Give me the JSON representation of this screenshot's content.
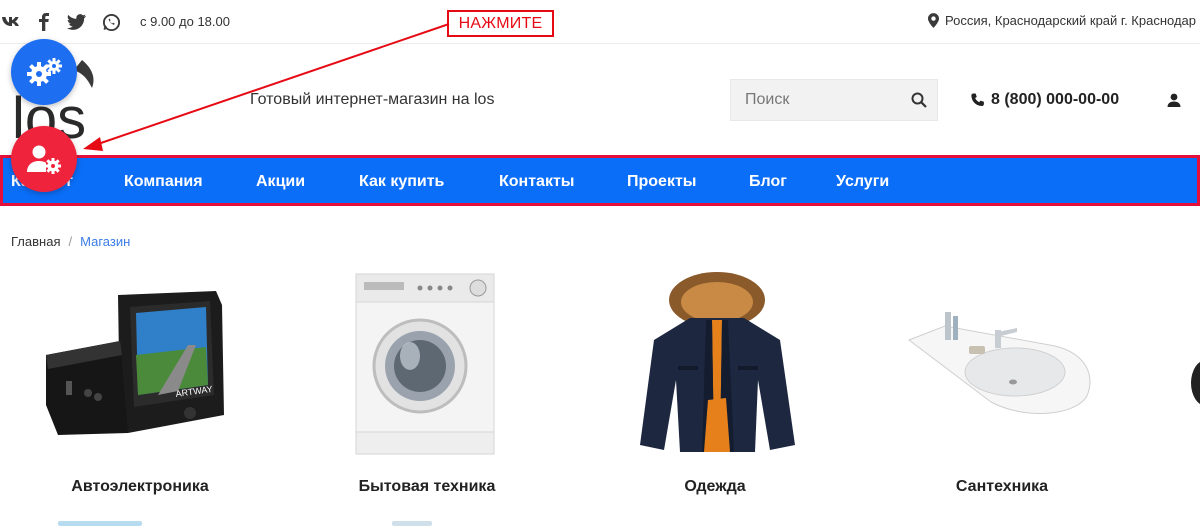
{
  "topbar": {
    "social": [
      "vk-icon",
      "facebook-icon",
      "twitter-icon",
      "whatsapp-icon"
    ],
    "hours": "с 9.00 до 18.00",
    "location": "Россия, Краснодарский край г. Краснодар"
  },
  "callout": {
    "label": "НАЖМИТЕ"
  },
  "header": {
    "logo_text": "los",
    "tagline": "Готовый интернет-магазин на los",
    "search_placeholder": "Поиск",
    "phone": "8 (800) 000-00-00"
  },
  "nav": {
    "items": [
      "Каталог",
      "Компания",
      "Акции",
      "Как купить",
      "Контакты",
      "Проекты",
      "Блог",
      "Услуги"
    ]
  },
  "breadcrumb": {
    "home": "Главная",
    "separator": "/",
    "current": "Магазин"
  },
  "categories": [
    {
      "title": "Автоэлектроника"
    },
    {
      "title": "Бытовая техника"
    },
    {
      "title": "Одежда"
    },
    {
      "title": "Сантехника"
    }
  ],
  "colors": {
    "nav": "#0b6ef8",
    "highlight": "#e60a14",
    "fab_settings": "#1e6ef2",
    "fab_user": "#f0233c",
    "link": "#3b7de6"
  }
}
